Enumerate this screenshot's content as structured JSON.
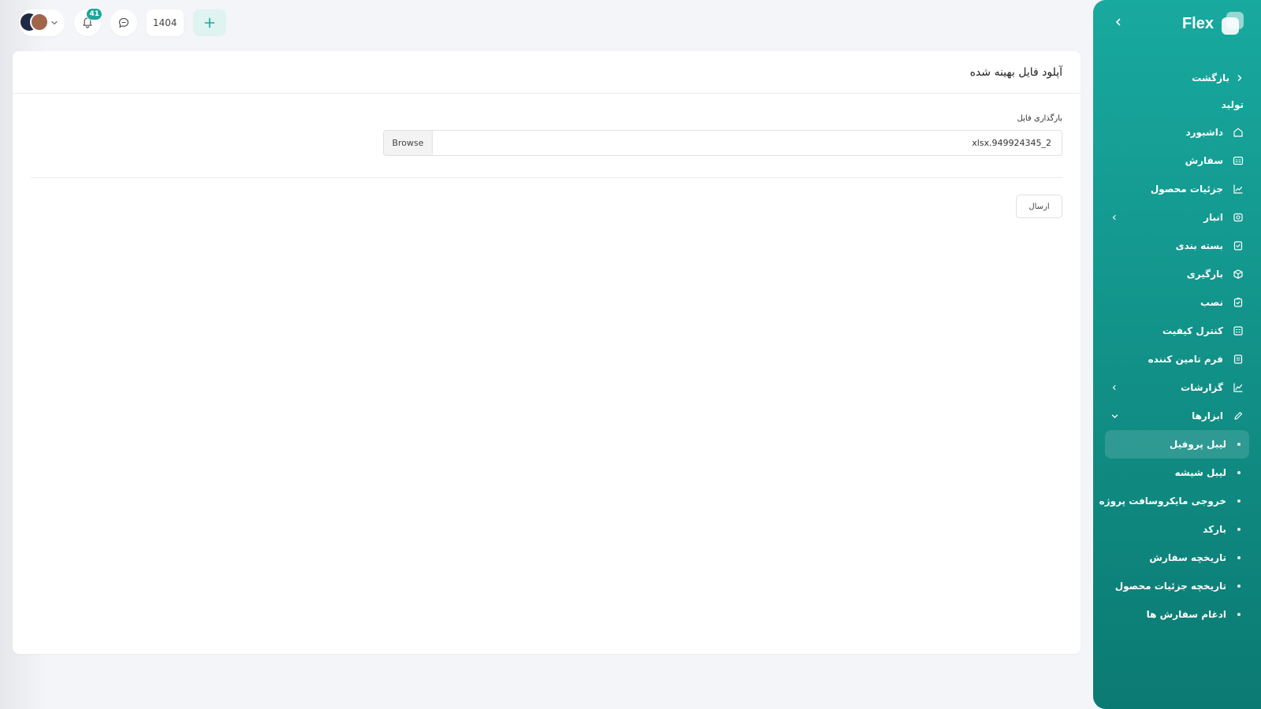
{
  "sidebar": {
    "brand_name": "Flex",
    "back_label": "بازگشت",
    "section_title": "تولید",
    "items": [
      {
        "label": "داشبورد",
        "icon": "home-icon"
      },
      {
        "label": "سفارش",
        "icon": "order-card-icon"
      },
      {
        "label": "جزئیات محصول",
        "icon": "chart-line-icon"
      },
      {
        "label": "انبار",
        "icon": "warehouse-icon"
      },
      {
        "label": "بسته بندی",
        "icon": "package-check-icon"
      },
      {
        "label": "بارگیری",
        "icon": "box-icon"
      },
      {
        "label": "نصب",
        "icon": "install-check-icon"
      },
      {
        "label": "کنترل کیفیت",
        "icon": "quality-grid-icon"
      },
      {
        "label": "فرم تامین کننده",
        "icon": "supplier-form-icon"
      },
      {
        "label": "گزارشات",
        "icon": "report-chart-icon"
      },
      {
        "label": "ابزارها",
        "icon": "pencil-icon"
      }
    ],
    "tools_subitems": [
      {
        "label": "لیبل پروفیل",
        "active": true
      },
      {
        "label": "لیبل شیشه"
      },
      {
        "label": "خروجی مایکروسافت پروژه"
      },
      {
        "label": "بارکد"
      },
      {
        "label": "تاریخچه سفارش"
      },
      {
        "label": "تاریخچه جزئیات محصول"
      },
      {
        "label": "ادغام سفارش ها"
      }
    ]
  },
  "topbar": {
    "notification_count": "41",
    "year": "1404"
  },
  "main": {
    "title": "آپلود فایل بهینه شده",
    "upload_label": "بارگذاری فایل",
    "file_name": "xlsx.949924345_2",
    "browse_label": "Browse",
    "submit_label": "ارسال"
  },
  "colors": {
    "sidebar_top": "#18a99f",
    "sidebar_bottom": "#0b7a72",
    "accent": "#19a89d",
    "background": "#f4f5f9"
  }
}
